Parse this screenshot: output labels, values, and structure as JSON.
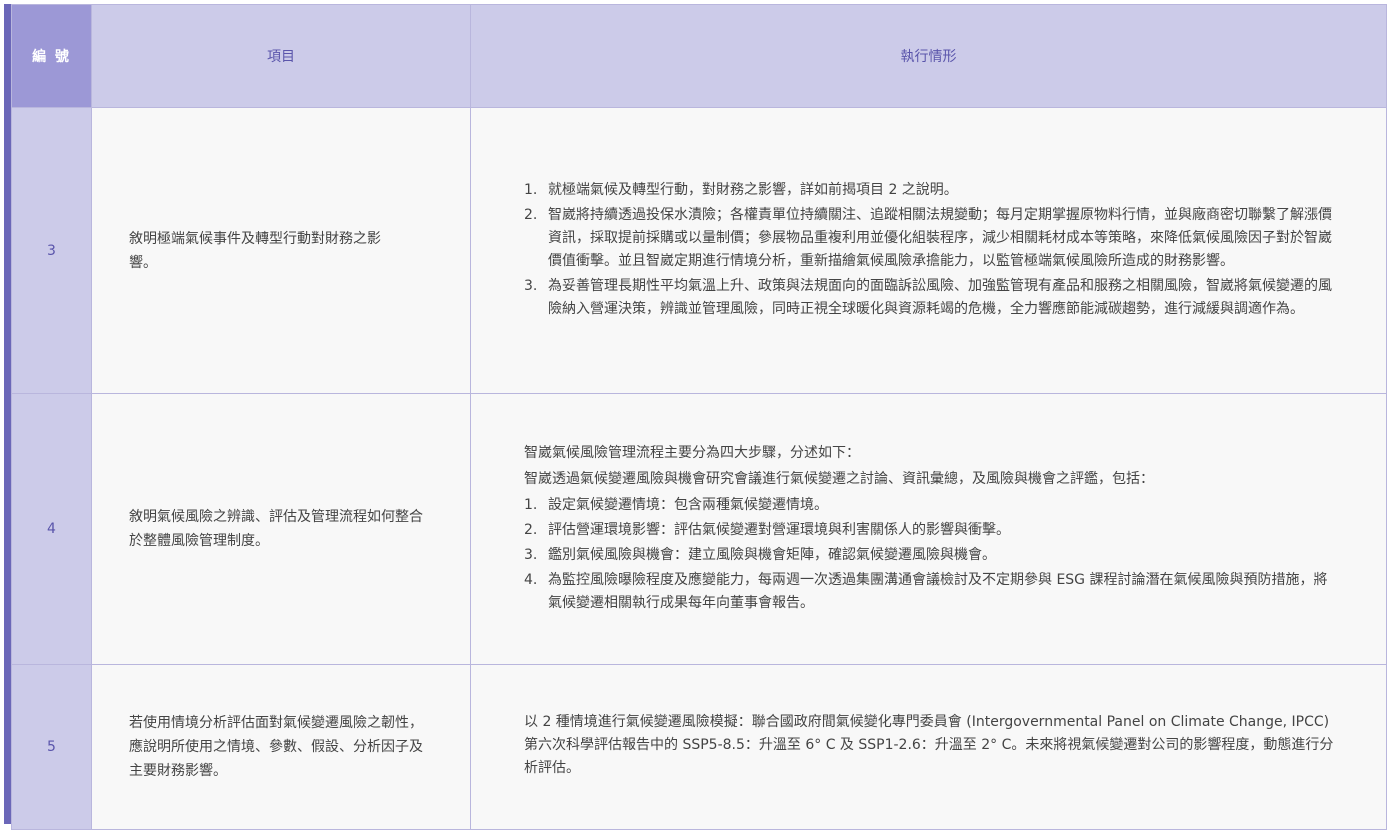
{
  "header": {
    "col_num": "編 號",
    "col_item": "項目",
    "col_status": "執行情形"
  },
  "rows": [
    {
      "num": "3",
      "item": "敘明極端氣候事件及轉型行動對財務之影響。",
      "intro": [],
      "steps": [
        {
          "n": "1.",
          "text": "就極端氣候及轉型行動，對財務之影響，詳如前揭項目 2 之說明。"
        },
        {
          "n": "2.",
          "text": "智崴將持續透過投保水漬險；各權責單位持續關注、追蹤相關法規變動；每月定期掌握原物料行情，並與廠商密切聯繫了解漲價資訊，採取提前採購或以量制價；參展物品重複利用並優化組裝程序，減少相關耗材成本等策略，來降低氣候風險因子對於智崴價值衝擊。並且智崴定期進行情境分析，重新描繪氣候風險承擔能力，以監管極端氣候風險所造成的財務影響。"
        },
        {
          "n": "3.",
          "text": "為妥善管理長期性平均氣溫上升、政策與法規面向的面臨訴訟風險、加強監管現有產品和服務之相關風險，智崴將氣候變遷的風險納入營運決策，辨識並管理風險，同時正視全球暖化與資源耗竭的危機，全力響應節能減碳趨勢，進行減緩與調適作為。"
        }
      ]
    },
    {
      "num": "4",
      "item": "敘明氣候風險之辨識、評估及管理流程如何整合於整體風險管理制度。",
      "intro": [
        "智崴氣候風險管理流程主要分為四大步驟，分述如下：",
        "智崴透過氣候變遷風險與機會研究會議進行氣候變遷之討論、資訊彙總，及風險與機會之評鑑，包括："
      ],
      "steps": [
        {
          "n": "1.",
          "text": "設定氣候變遷情境：包含兩種氣候變遷情境。"
        },
        {
          "n": "2.",
          "text": "評估營運環境影響：評估氣候變遷對營運環境與利害關係人的影響與衝擊。"
        },
        {
          "n": "3.",
          "text": "鑑別氣候風險與機會：建立風險與機會矩陣，確認氣候變遷風險與機會。"
        },
        {
          "n": "4.",
          "text": "為監控風險曝險程度及應變能力，每兩週一次透過集團溝通會議檢討及不定期參與 ESG 課程討論潛在氣候風險與預防措施，將氣候變遷相關執行成果每年向董事會報告。"
        }
      ]
    },
    {
      "num": "5",
      "item": "若使用情境分析評估面對氣候變遷風險之韌性，應說明所使用之情境、參數、假設、分析因子及主要財務影響。",
      "intro": [
        "以 2 種情境進行氣候變遷風險模擬：聯合國政府間氣候變化專門委員會 (Intergovernmental Panel on Climate Change, IPCC) 第六次科學評估報告中的 SSP5-8.5：升溫至 6° C 及 SSP1-2.6：升溫至 2° C。未來將視氣候變遷對公司的影響程度，動態進行分析評估。"
      ],
      "steps": []
    }
  ],
  "colors": {
    "accent": "#6b67b8",
    "header_bg": "#cccbe9",
    "num_header_bg": "#9c98d6",
    "cell_bg": "#f8f8f8",
    "border": "#b9b6dd"
  }
}
